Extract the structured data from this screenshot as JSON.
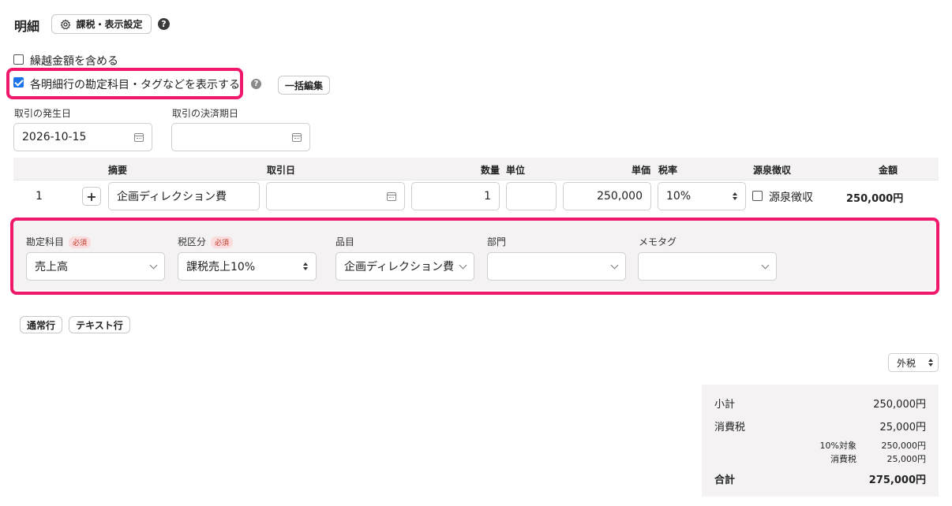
{
  "header": {
    "title": "明細",
    "settings_button": "課税・表示設定",
    "help": "?"
  },
  "options": {
    "include_carryover": {
      "label": "繰越金額を含める",
      "checked": false
    },
    "show_account_tags": {
      "label": "各明細行の勘定科目・タグなどを表示する",
      "checked": true
    },
    "bulk_edit_button": "一括編集"
  },
  "dates": {
    "issue_date": {
      "label": "取引の発生日",
      "value": "2026-10-15"
    },
    "payment_date": {
      "label": "取引の決済期日",
      "value": ""
    }
  },
  "table": {
    "headers": {
      "summary": "摘要",
      "date": "取引日",
      "quantity": "数量",
      "unit": "単位",
      "unit_price": "単価",
      "tax_rate": "税率",
      "withholding": "源泉徴収",
      "amount": "金額"
    },
    "row": {
      "number": "1",
      "add": "+",
      "summary": "企画ディレクション費",
      "date": "",
      "quantity": "1",
      "unit": "",
      "unit_price": "250,000",
      "tax_rate": "10%",
      "withholding_label": "源泉徴収",
      "amount": "250,000円"
    }
  },
  "detail": {
    "account": {
      "label": "勘定科目",
      "required": "必須",
      "value": "売上高"
    },
    "tax_category": {
      "label": "税区分",
      "required": "必須",
      "value": "課税売上10%"
    },
    "item": {
      "label": "品目",
      "value": "企画ディレクション費"
    },
    "department": {
      "label": "部門",
      "value": ""
    },
    "memo_tag": {
      "label": "メモタグ",
      "value": ""
    }
  },
  "row_buttons": {
    "normal": "通常行",
    "text": "テキスト行"
  },
  "tax_mode": "外税",
  "totals": {
    "subtotal_label": "小計",
    "subtotal": "250,000円",
    "tax_label": "消費税",
    "tax": "25,000円",
    "target_label": "10%対象",
    "target": "250,000円",
    "target_tax_label": "消費税",
    "target_tax": "25,000円",
    "total_label": "合計",
    "total": "275,000円"
  },
  "colors": {
    "highlight": "#f0186a",
    "checkbox": "#1a73e8",
    "panel_bg": "#f4f2f2"
  }
}
